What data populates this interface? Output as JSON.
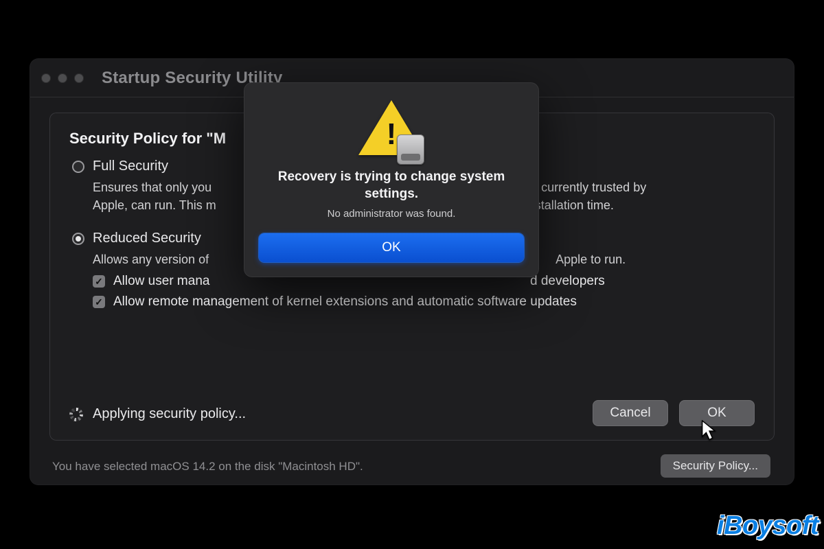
{
  "window": {
    "title": "Startup Security Utility"
  },
  "panel": {
    "title": "Security Policy for \"M",
    "options": {
      "full": {
        "label": "Full Security",
        "selected": false,
        "desc_left": "Ensures that only you",
        "desc_right": "currently trusted by",
        "desc2_left": "Apple, can run. This m",
        "desc2_right": "stallation time."
      },
      "reduced": {
        "label": "Reduced Security",
        "selected": true,
        "desc_left": "Allows any version of",
        "desc_right": "Apple to run.",
        "check1_left": "Allow user mana",
        "check1_right": "d developers",
        "check2": "Allow remote management of kernel extensions and automatic software updates"
      }
    },
    "status": "Applying security policy...",
    "buttons": {
      "cancel": "Cancel",
      "ok": "OK"
    }
  },
  "footer": {
    "text": "You have selected macOS 14.2 on the disk \"Macintosh HD\".",
    "button": "Security Policy..."
  },
  "modal": {
    "title": "Recovery is trying to change system settings.",
    "subtitle": "No administrator was found.",
    "ok": "OK"
  },
  "watermark": "iBoysoft"
}
